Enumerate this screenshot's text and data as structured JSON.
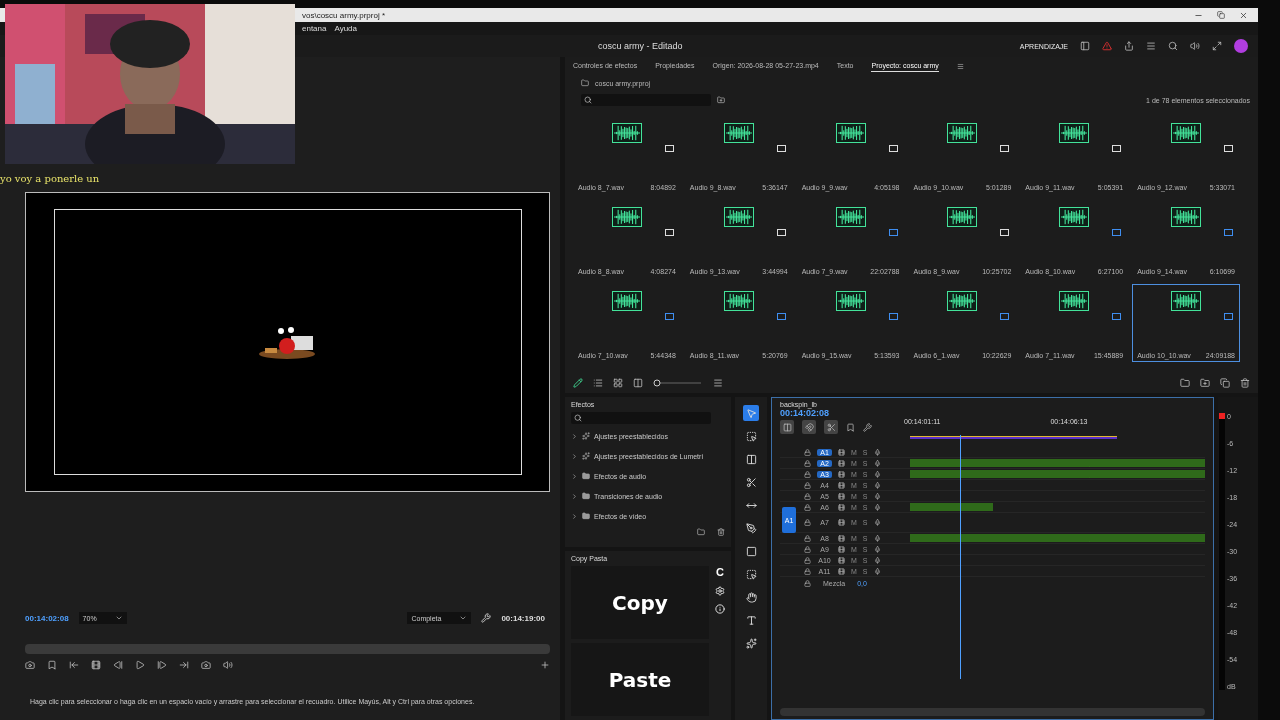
{
  "window": {
    "title": "vos\\coscu army.prproj *",
    "menu": [
      "entana",
      "Ayuda"
    ]
  },
  "header": {
    "project": "coscu army - Editado",
    "workspace": "APRENDIZAJE"
  },
  "webcam": {
    "kind": "picture",
    "caption": "yo voy a ponerle un"
  },
  "program_monitor": {
    "timecode": "00:14:02:08",
    "zoom": "70%",
    "quality": "Completa",
    "duration": "00:14:19:00"
  },
  "panel_tabs": [
    {
      "label": "Controles de efectos",
      "selected": false
    },
    {
      "label": "Propiedades",
      "selected": false
    },
    {
      "label": "Origen: 2026-08-28 05-27-23.mp4",
      "selected": false
    },
    {
      "label": "Texto",
      "selected": false
    },
    {
      "label": "Proyecto: coscu army",
      "selected": true
    }
  ],
  "project": {
    "file": "coscu army.prproj",
    "thumbnail_size": {
      "level": 0
    },
    "selection_count": "1 de 78 elementos seleccionados",
    "items": [
      {
        "name": "Audio 8_7.wav",
        "duration": "8:04892",
        "in_sequence": false,
        "selected": false
      },
      {
        "name": "Audio 9_8.wav",
        "duration": "5:36147",
        "in_sequence": false,
        "selected": false
      },
      {
        "name": "Audio 9_9.wav",
        "duration": "4:05198",
        "in_sequence": false,
        "selected": false
      },
      {
        "name": "Audio 9_10.wav",
        "duration": "5:01289",
        "in_sequence": false,
        "selected": false
      },
      {
        "name": "Audio 9_11.wav",
        "duration": "5:05391",
        "in_sequence": false,
        "selected": false
      },
      {
        "name": "Audio 9_12.wav",
        "duration": "5:33071",
        "in_sequence": false,
        "selected": false
      },
      {
        "name": "Audio 8_8.wav",
        "duration": "4:08274",
        "in_sequence": false,
        "selected": false
      },
      {
        "name": "Audio 9_13.wav",
        "duration": "3:44994",
        "in_sequence": false,
        "selected": false
      },
      {
        "name": "Audio 7_9.wav",
        "duration": "22:02788",
        "in_sequence": true,
        "selected": false
      },
      {
        "name": "Audio 8_9.wav",
        "duration": "10:25702",
        "in_sequence": false,
        "selected": false
      },
      {
        "name": "Audio 8_10.wav",
        "duration": "6:27100",
        "in_sequence": true,
        "selected": false
      },
      {
        "name": "Audio 9_14.wav",
        "duration": "6:10699",
        "in_sequence": true,
        "selected": false
      },
      {
        "name": "Audio 7_10.wav",
        "duration": "5:44348",
        "in_sequence": true,
        "selected": false
      },
      {
        "name": "Audio 8_11.wav",
        "duration": "5:20769",
        "in_sequence": true,
        "selected": false
      },
      {
        "name": "Audio 9_15.wav",
        "duration": "5:13593",
        "in_sequence": true,
        "selected": false
      },
      {
        "name": "Audio 6_1.wav",
        "duration": "10:22629",
        "in_sequence": true,
        "selected": false
      },
      {
        "name": "Audio 7_11.wav",
        "duration": "15:45889",
        "in_sequence": true,
        "selected": false
      },
      {
        "name": "Audio 10_10.wav",
        "duration": "24:09188",
        "in_sequence": true,
        "selected": true
      }
    ]
  },
  "effects": {
    "title": "Efectos",
    "items": [
      {
        "label": "Ajustes preestablecidos",
        "kind": "preset"
      },
      {
        "label": "Ajustes preestablecidos de Lumetri",
        "kind": "preset"
      },
      {
        "label": "Efectos de audio",
        "kind": "folder"
      },
      {
        "label": "Transiciones de audio",
        "kind": "folder"
      },
      {
        "label": "Efectos de vídeo",
        "kind": "folder"
      }
    ]
  },
  "copy_pasta": {
    "title": "Copy Pasta",
    "buttons": [
      "Copy",
      "Paste"
    ],
    "side_label": "C"
  },
  "tools": [
    {
      "selected": true
    },
    {
      "selected": false
    },
    {
      "selected": false
    },
    {
      "selected": false
    },
    {
      "selected": false
    },
    {
      "selected": false
    },
    {
      "selected": false
    },
    {
      "selected": false
    },
    {
      "selected": false
    },
    {
      "selected": false
    },
    {
      "selected": false
    }
  ],
  "timeline": {
    "sequence": "backspin_lb",
    "timecode": "00:14:02:08",
    "ruler": [
      "00:14:01:11",
      "00:14:06:13"
    ],
    "tracks": [
      {
        "label": "A1",
        "targeted": true,
        "kind": "empty",
        "mute": "M",
        "solo": "S"
      },
      {
        "label": "A2",
        "targeted": true,
        "kind": "long",
        "mute": "M",
        "solo": "S"
      },
      {
        "label": "A3",
        "targeted": true,
        "kind": "long",
        "mute": "M",
        "solo": "S"
      },
      {
        "label": "A4",
        "targeted": false,
        "kind": "empty",
        "mute": "M",
        "solo": "S"
      },
      {
        "label": "A5",
        "targeted": false,
        "kind": "empty",
        "mute": "M",
        "solo": "S"
      },
      {
        "label": "A6",
        "targeted": false,
        "kind": "short",
        "mute": "M",
        "solo": "S"
      },
      {
        "label": "A7",
        "targeted": false,
        "kind": "empty",
        "mute": "M",
        "solo": "S",
        "source_patch": "A1"
      },
      {
        "label": "A8",
        "targeted": false,
        "kind": "long",
        "mute": "M",
        "solo": "S"
      },
      {
        "label": "A9",
        "targeted": false,
        "kind": "empty",
        "mute": "M",
        "solo": "S"
      },
      {
        "label": "A10",
        "targeted": false,
        "kind": "empty",
        "mute": "M",
        "solo": "S"
      },
      {
        "label": "A11",
        "targeted": false,
        "kind": "empty",
        "mute": "M",
        "solo": "S"
      }
    ],
    "mix": {
      "label": "Mezcla",
      "value": "0,0"
    }
  },
  "meter": {
    "labels": [
      "0",
      "-6",
      "-12",
      "-18",
      "-24",
      "-30",
      "-36",
      "-42",
      "-48",
      "-54",
      "dB"
    ]
  },
  "status_bar": "Haga clic para seleccionar o haga clic en un espacio vacío y arrastre para seleccionar el recuadro. Utilice Mayús, Alt y Ctrl para otras opciones."
}
